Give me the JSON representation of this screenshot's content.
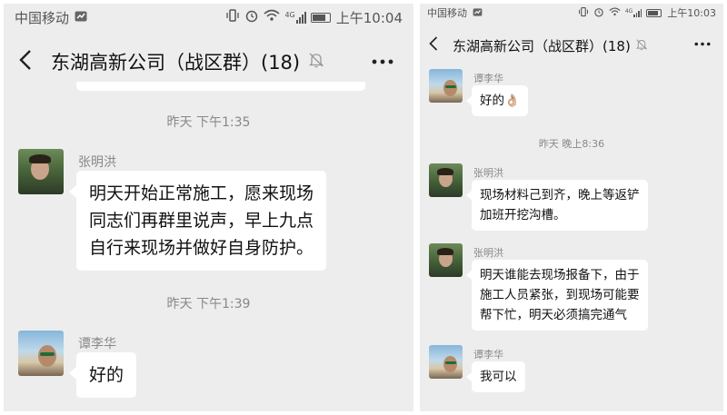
{
  "left": {
    "status": {
      "carrier": "中国移动",
      "signal_badge": "4G",
      "time": "上午10:04"
    },
    "header": {
      "back_icon": "chevron-left-icon",
      "title": "东湖高新公司（战区群）(18)",
      "mute_icon": "bell-off-icon",
      "more_icon": "more-horizontal-icon"
    },
    "messages": [
      {
        "type": "timestamp",
        "text": "昨天 下午1:35"
      },
      {
        "type": "message",
        "sender": "张明洪",
        "avatar": "zhang",
        "lines": [
          "明天开始正常施工，愿来现场",
          "同志们再群里说声，早上九点",
          "自行来现场并做好自身防护。"
        ]
      },
      {
        "type": "timestamp",
        "text": "昨天 下午1:39"
      },
      {
        "type": "message",
        "sender": "谭李华",
        "avatar": "tan",
        "lines": [
          "好的"
        ]
      }
    ]
  },
  "right": {
    "status": {
      "carrier": "中国移动",
      "signal_badge": "4G",
      "time": "上午10:03"
    },
    "header": {
      "back_icon": "chevron-left-icon",
      "title": "东湖高新公司（战区群）(18)",
      "mute_icon": "bell-off-icon",
      "more_icon": "more-horizontal-icon"
    },
    "messages": [
      {
        "type": "message",
        "sender": "谭李华",
        "avatar": "tan",
        "lines": [
          "好的👌🏼"
        ]
      },
      {
        "type": "timestamp",
        "text": "昨天 晚上8:36"
      },
      {
        "type": "message",
        "sender": "张明洪",
        "avatar": "zhang",
        "lines": [
          "现场材料己到齐，晚上等返铲",
          "加班开挖沟槽。"
        ]
      },
      {
        "type": "message",
        "sender": "张明洪",
        "avatar": "zhang",
        "lines": [
          "明天谁能去现场报备下，由于",
          "施工人员紧张，到现场可能要",
          "帮下忙，明天必须搞完通气"
        ]
      },
      {
        "type": "message",
        "sender": "谭李华",
        "avatar": "tan",
        "lines": [
          "我可以"
        ]
      }
    ]
  }
}
